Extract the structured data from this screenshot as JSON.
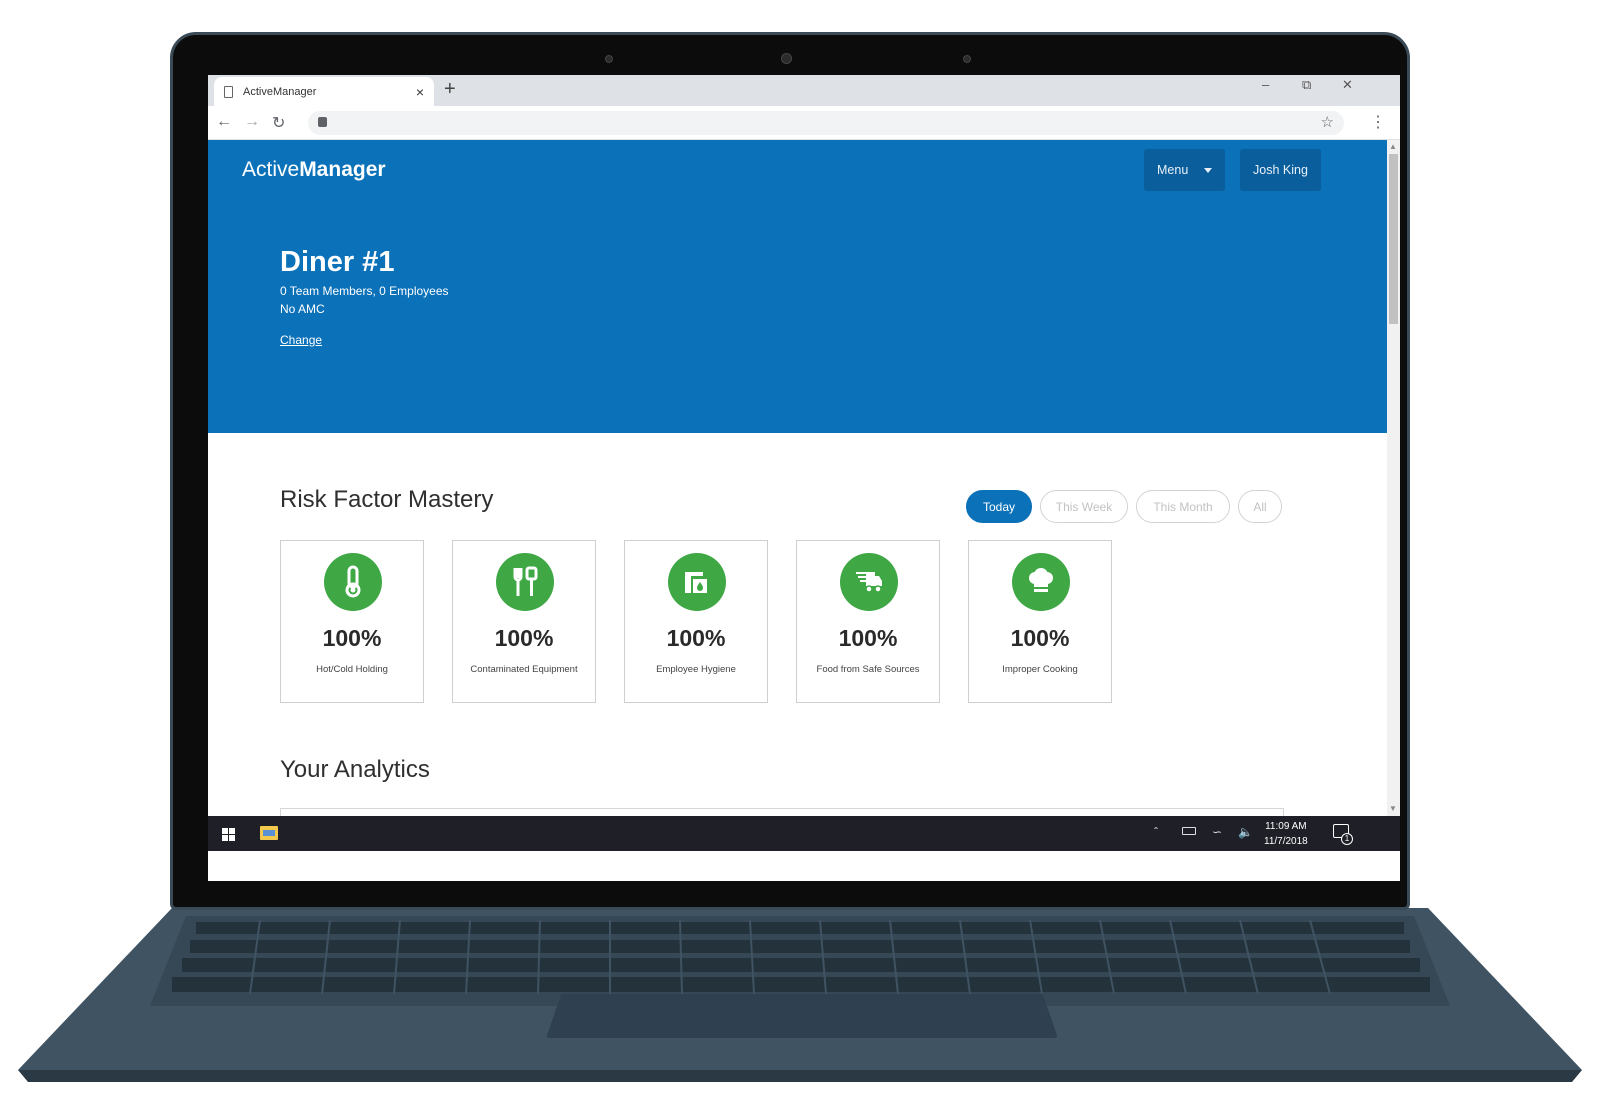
{
  "browser": {
    "tab_title": "ActiveManager",
    "new_tab_glyph": "+",
    "close_glyph": "×"
  },
  "app": {
    "brand_light": "Active",
    "brand_bold": "Manager",
    "menu_label": "Menu",
    "user_label": "Josh King"
  },
  "store": {
    "name": "Diner #1",
    "members": "0 Team Members, 0 Employees",
    "amc": "No AMC",
    "change_label": "Change"
  },
  "risk": {
    "title": "Risk Factor Mastery",
    "filters": [
      "Today",
      "This Week",
      "This Month",
      "All"
    ],
    "active_filter": "Today",
    "cards": [
      {
        "icon": "thermometer-icon",
        "value": "100%",
        "label": "Hot/Cold Holding"
      },
      {
        "icon": "utensils-icon",
        "value": "100%",
        "label": "Contaminated Equipment"
      },
      {
        "icon": "hand-sink-icon",
        "value": "100%",
        "label": "Employee Hygiene"
      },
      {
        "icon": "delivery-truck-icon",
        "value": "100%",
        "label": "Food from Safe Sources"
      },
      {
        "icon": "chef-hat-icon",
        "value": "100%",
        "label": "Improper Cooking"
      }
    ]
  },
  "analytics": {
    "title": "Your Analytics"
  },
  "taskbar": {
    "time": "11:09 AM",
    "date": "11/7/2018",
    "notification_count": "1"
  },
  "colors": {
    "brand_blue": "#0b71b9",
    "success_green": "#3fa845"
  }
}
